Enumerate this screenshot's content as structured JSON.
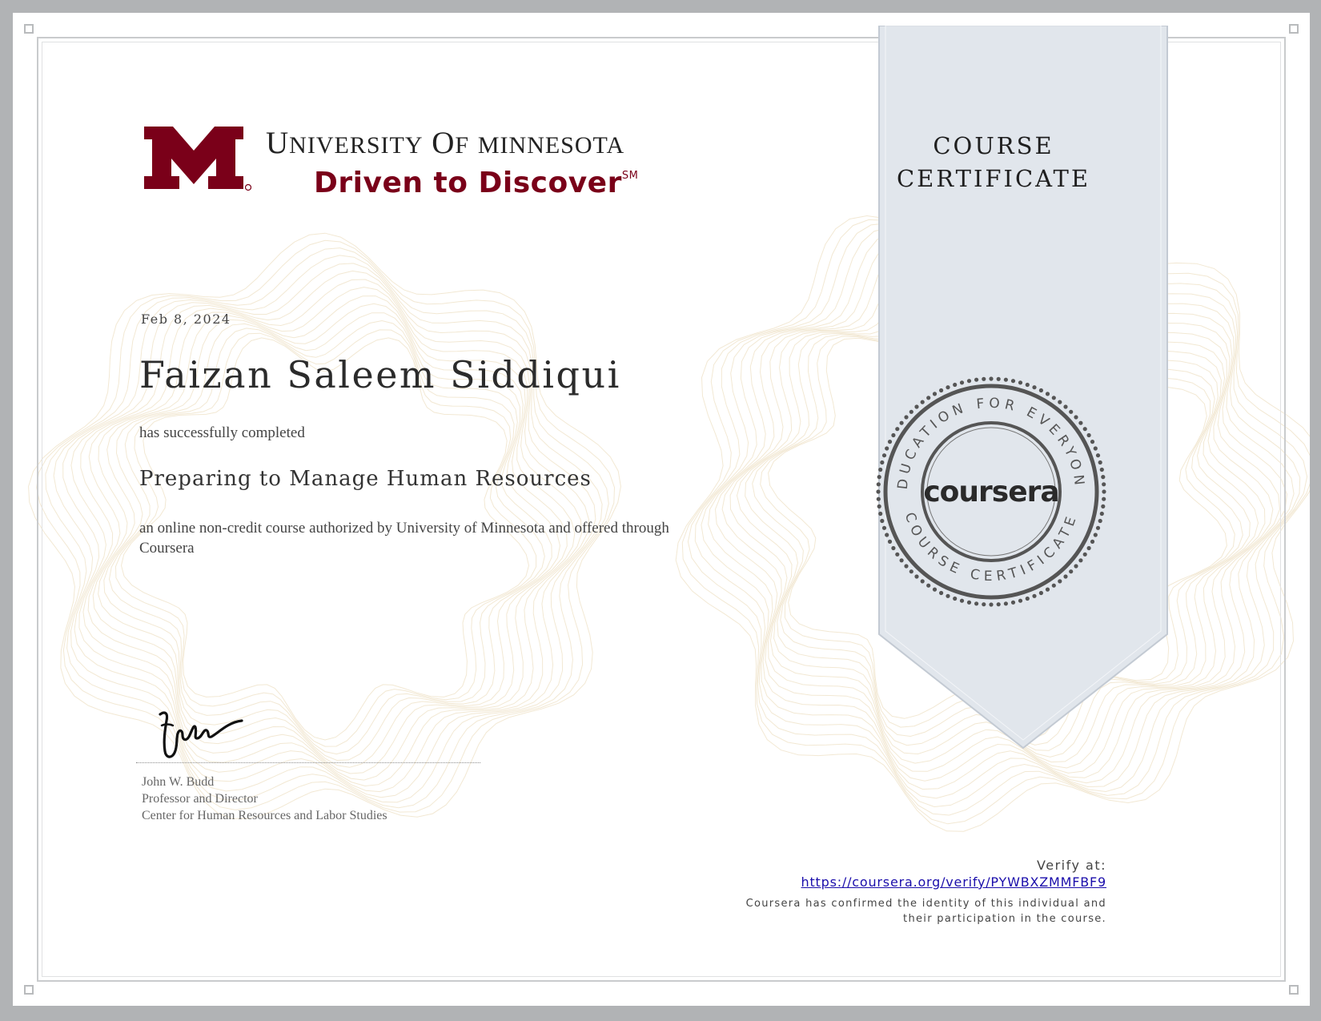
{
  "brand": {
    "university_name": "University of Minnesota",
    "tagline": "Driven to Discover",
    "tagline_mark": "SM",
    "logo_color": "#7a0019"
  },
  "certificate": {
    "title_line1": "COURSE",
    "title_line2": "CERTIFICATE",
    "date": "Feb 8, 2024",
    "learner_name": "Faizan Saleem Siddiqui",
    "completed_text": "has successfully completed",
    "course_name": "Preparing to Manage Human Resources",
    "description": "an online non-credit course authorized by University of Minnesota and offered through Coursera"
  },
  "signer": {
    "name": "John W. Budd",
    "title": "Professor and Director",
    "department": "Center for Human Resources and Labor Studies"
  },
  "seal": {
    "top_text": "EDUCATION FOR EVERYONE",
    "bottom_text": "COURSE CERTIFICATE",
    "wordmark": "coursera"
  },
  "verify": {
    "label": "Verify at:",
    "url": "https://coursera.org/verify/PYWBXZMMFBF9",
    "confirmation": "Coursera has confirmed the identity of this individual and their participation in the course."
  },
  "colors": {
    "ribbon": "#e1e6ec",
    "link": "#1a0dab"
  }
}
